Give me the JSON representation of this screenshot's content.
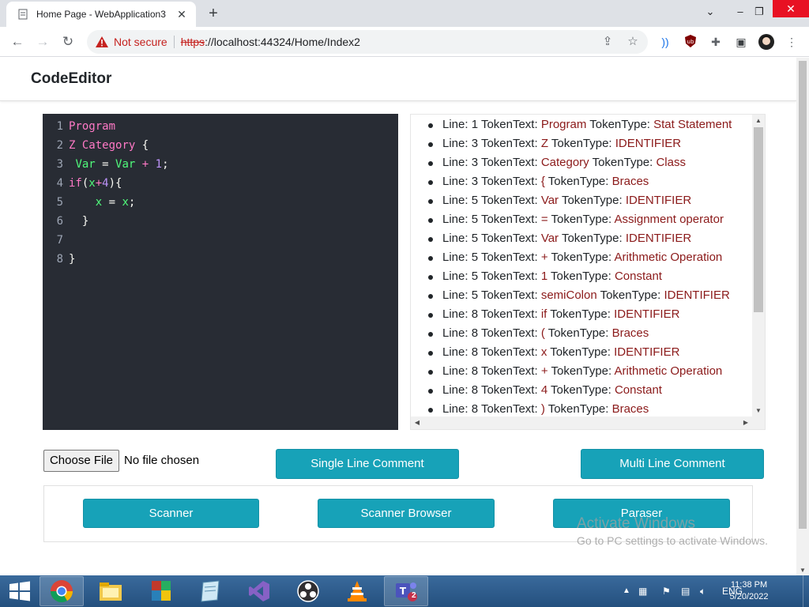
{
  "browser": {
    "tab_title": "Home Page - WebApplication3",
    "tab_close": "✕",
    "new_tab": "+",
    "security_label": "Not secure",
    "url_protocol": "https",
    "url_rest": "://localhost:44324/Home/Index2",
    "icons": [
      "back-icon",
      "forward-icon",
      "reload-icon",
      "warning-icon",
      "share-icon",
      "star-icon",
      "extensions-icon",
      "sidepanel-icon",
      "profile-icon",
      "menu-icon"
    ]
  },
  "app": {
    "brand": "CodeEditor"
  },
  "editor": {
    "lines": [
      {
        "n": "1",
        "html": "<span class='kw'>Program</span>"
      },
      {
        "n": "2",
        "html": "<span class='kw'>Z</span> <span class='kw'>Category</span> <span class='punc'>{</span>"
      },
      {
        "n": "3",
        "html": " <span class='var'>Var</span> <span class='punc'>=</span> <span class='var'>Var</span> <span class='op'>+</span> <span class='num'>1</span><span class='punc'>;</span>"
      },
      {
        "n": "4",
        "html": "<span class='kw'>if</span><span class='punc'>(</span><span class='var'>x</span><span class='op'>+</span><span class='num'>4</span><span class='punc'>){</span>"
      },
      {
        "n": "5",
        "html": "    <span class='var'>x</span> <span class='punc'>=</span> <span class='var'>x</span><span class='punc'>;</span>"
      },
      {
        "n": "6",
        "html": "  <span class='punc'>}</span>"
      },
      {
        "n": "7",
        "html": ""
      },
      {
        "n": "8",
        "html": "<span class='punc'>}</span>"
      }
    ]
  },
  "tokens": [
    {
      "line": "1",
      "text": "Program",
      "type": "Stat Statement"
    },
    {
      "line": "3",
      "text": "Z",
      "type": "IDENTIFIER"
    },
    {
      "line": "3",
      "text": "Category",
      "type": "Class"
    },
    {
      "line": "3",
      "text": "{",
      "type": "Braces"
    },
    {
      "line": "5",
      "text": "Var",
      "type": "IDENTIFIER"
    },
    {
      "line": "5",
      "text": "=",
      "type": "Assignment operator"
    },
    {
      "line": "5",
      "text": "Var",
      "type": "IDENTIFIER"
    },
    {
      "line": "5",
      "text": "+",
      "type": "Arithmetic Operation"
    },
    {
      "line": "5",
      "text": "1",
      "type": "Constant"
    },
    {
      "line": "5",
      "text": "semiColon",
      "type": "IDENTIFIER"
    },
    {
      "line": "8",
      "text": "if",
      "type": "IDENTIFIER"
    },
    {
      "line": "8",
      "text": "(",
      "type": "Braces"
    },
    {
      "line": "8",
      "text": "x",
      "type": "IDENTIFIER"
    },
    {
      "line": "8",
      "text": "+",
      "type": "Arithmetic Operation"
    },
    {
      "line": "8",
      "text": "4",
      "type": "Constant"
    },
    {
      "line": "8",
      "text": ")",
      "type": "Braces"
    }
  ],
  "token_labels": {
    "line": "Line: ",
    "text": "TokenText: ",
    "type": "TokenType: "
  },
  "controls": {
    "choose_file": "Choose File",
    "no_file": "No file chosen",
    "single_line_comment": "Single Line Comment",
    "multi_line_comment": "Multi Line Comment",
    "scanner": "Scanner",
    "scanner_browser": "Scanner Browser",
    "paraser": "Paraser"
  },
  "watermark": {
    "line1": "Activate Windows",
    "line2": "Go to PC settings to activate Windows."
  },
  "taskbar": {
    "language": "ENG",
    "time": "11:38 PM",
    "date": "5/20/2022",
    "teams_badge": "2",
    "apps": [
      "chrome-icon",
      "file-explorer-icon",
      "winrar-icon",
      "notepad-icon",
      "visual-studio-icon",
      "obs-icon",
      "vlc-icon",
      "teams-icon"
    ]
  },
  "colors": {
    "accent_button": "#17a2b8",
    "editor_bg": "#282c34",
    "token_value": "#8b1a1a"
  }
}
